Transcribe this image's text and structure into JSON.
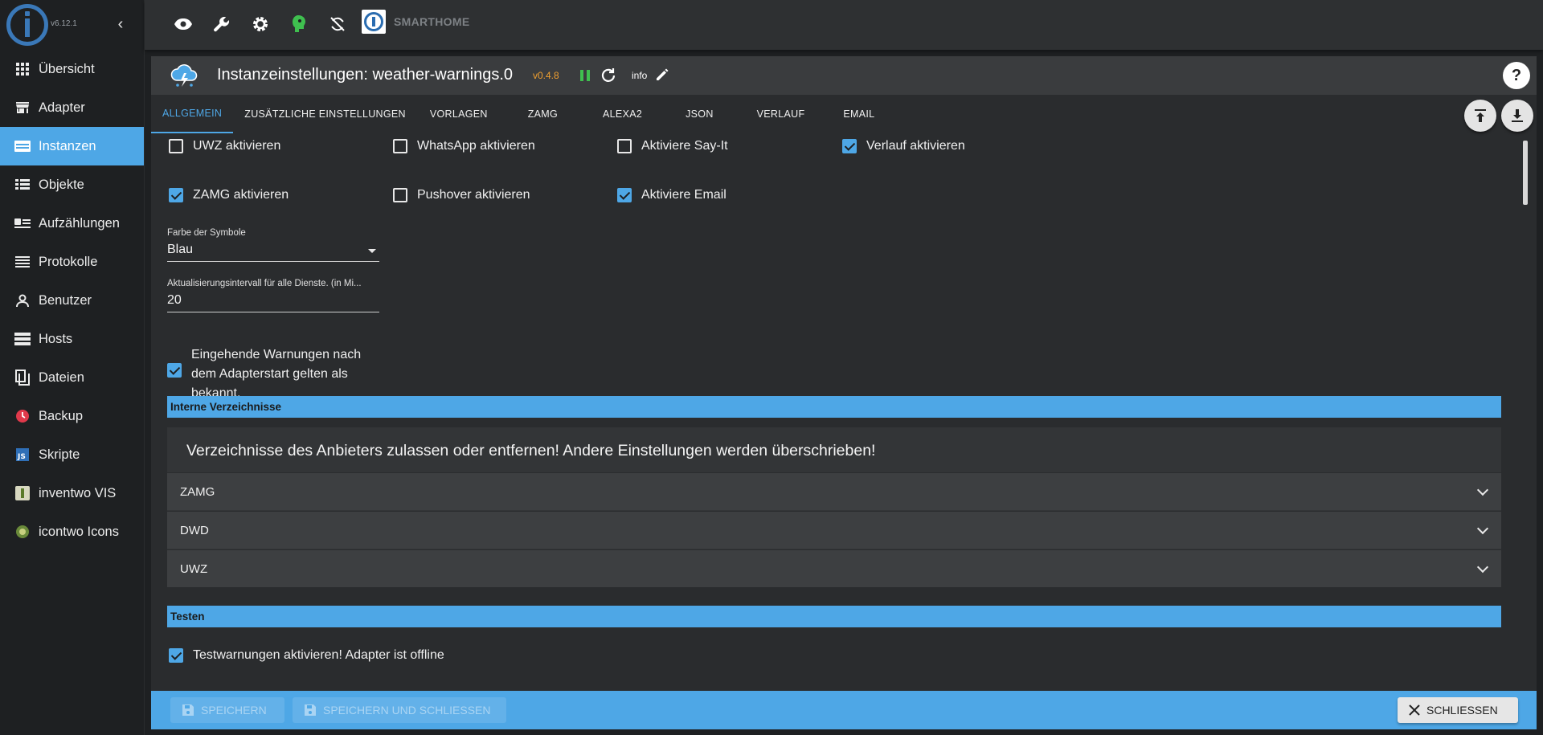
{
  "app": {
    "version": "v6.12.1",
    "brand_title": "SMARTHOME"
  },
  "sidebar": {
    "items": [
      {
        "label": "Übersicht",
        "icon": "grid-icon"
      },
      {
        "label": "Adapter",
        "icon": "store-icon"
      },
      {
        "label": "Instanzen",
        "icon": "instances-icon",
        "active": true
      },
      {
        "label": "Objekte",
        "icon": "list-icon"
      },
      {
        "label": "Aufzählungen",
        "icon": "enum-icon"
      },
      {
        "label": "Protokolle",
        "icon": "log-icon"
      },
      {
        "label": "Benutzer",
        "icon": "user-icon"
      },
      {
        "label": "Hosts",
        "icon": "hosts-icon"
      },
      {
        "label": "Dateien",
        "icon": "files-icon"
      },
      {
        "label": "Backup",
        "icon": "backup-icon"
      },
      {
        "label": "Skripte",
        "icon": "js-icon"
      },
      {
        "label": "inventwo VIS",
        "icon": "inventwo-icon"
      },
      {
        "label": "icontwo Icons",
        "icon": "icontwo-icon"
      }
    ]
  },
  "panel": {
    "title": "Instanzeinstellungen: weather-warnings.0",
    "version": "v0.4.8",
    "info": "info",
    "help": "?"
  },
  "tabs": [
    {
      "label": "ALLGEMEIN",
      "active": true
    },
    {
      "label": "ZUSÄTZLICHE EINSTELLUNGEN"
    },
    {
      "label": "VORLAGEN"
    },
    {
      "label": "ZAMG"
    },
    {
      "label": "ALEXA2"
    },
    {
      "label": "JSON"
    },
    {
      "label": "VERLAUF"
    },
    {
      "label": "EMAIL"
    }
  ],
  "settings": {
    "checkboxes": {
      "uwz": {
        "label": "UWZ aktivieren",
        "checked": false
      },
      "whatsapp": {
        "label": "WhatsApp aktivieren",
        "checked": false
      },
      "sayit": {
        "label": "Aktiviere Say-It",
        "checked": false
      },
      "verlauf": {
        "label": "Verlauf aktivieren",
        "checked": true
      },
      "zamg": {
        "label": "ZAMG aktivieren",
        "checked": true
      },
      "pushover": {
        "label": "Pushover aktivieren",
        "checked": false
      },
      "email": {
        "label": "Aktiviere Email",
        "checked": true
      }
    },
    "symbol_color": {
      "label": "Farbe der Symbole",
      "value": "Blau"
    },
    "interval": {
      "label": "Aktualisierungsintervall für alle Dienste. (in Mi...",
      "value": "20"
    },
    "known_warnings": {
      "label": "Eingehende Warnungen nach dem Adapterstart gelten als bekannt.",
      "checked": true
    }
  },
  "sections": {
    "internal": "Interne Verzeichnisse",
    "test": "Testen"
  },
  "directories": {
    "title": "Verzeichnisse des Anbieters zulassen oder entfernen! Andere Einstellungen werden überschrieben!",
    "items": [
      "ZAMG",
      "DWD",
      "UWZ"
    ]
  },
  "test": {
    "label": "Testwarnungen aktivieren! Adapter ist offline",
    "checked": true
  },
  "footer": {
    "save": "SPEICHERN",
    "save_close": "SPEICHERN UND SCHLIESSEN",
    "close": "SCHLIESSEN"
  },
  "colors": {
    "accent": "#4ea7e6",
    "version": "#f0a030",
    "status_green": "#3fbf4f"
  }
}
